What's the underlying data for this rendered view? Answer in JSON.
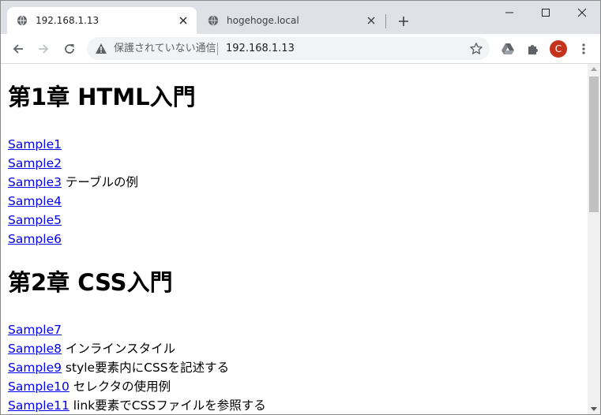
{
  "tabs": [
    {
      "title": "192.168.1.13",
      "active": true
    },
    {
      "title": "hogehoge.local",
      "active": false
    }
  ],
  "omnibox": {
    "security_label": "保護されていない通信",
    "url": "192.168.1.13"
  },
  "profile": {
    "initial": "C",
    "color": "#c5331d"
  },
  "icons": {
    "tab": "globe-icon",
    "nav": [
      "back-icon",
      "forward-icon",
      "reload-icon"
    ],
    "omnibox": [
      "warning-icon",
      "bookmark-star-icon"
    ],
    "extensions": [
      "google-drive-icon",
      "puzzle-piece-icon"
    ],
    "menu": "kebab-menu-icon"
  },
  "page": {
    "chapters": [
      {
        "heading": "第1章 HTML入門",
        "items": [
          {
            "link": "Sample1",
            "desc": ""
          },
          {
            "link": "Sample2",
            "desc": ""
          },
          {
            "link": "Sample3",
            "desc": "テーブルの例"
          },
          {
            "link": "Sample4",
            "desc": ""
          },
          {
            "link": "Sample5",
            "desc": ""
          },
          {
            "link": "Sample6",
            "desc": ""
          }
        ]
      },
      {
        "heading": "第2章 CSS入門",
        "items": [
          {
            "link": "Sample7",
            "desc": ""
          },
          {
            "link": "Sample8",
            "desc": "インラインスタイル"
          },
          {
            "link": "Sample9",
            "desc": "style要素内にCSSを記述する"
          },
          {
            "link": "Sample10",
            "desc": "セレクタの使用例"
          },
          {
            "link": "Sample11",
            "desc": "link要素でCSSファイルを参照する"
          }
        ]
      }
    ]
  },
  "colors": {
    "link": "#0000ee",
    "tabbar": "#dee1e6",
    "omnibox": "#f1f3f4"
  }
}
